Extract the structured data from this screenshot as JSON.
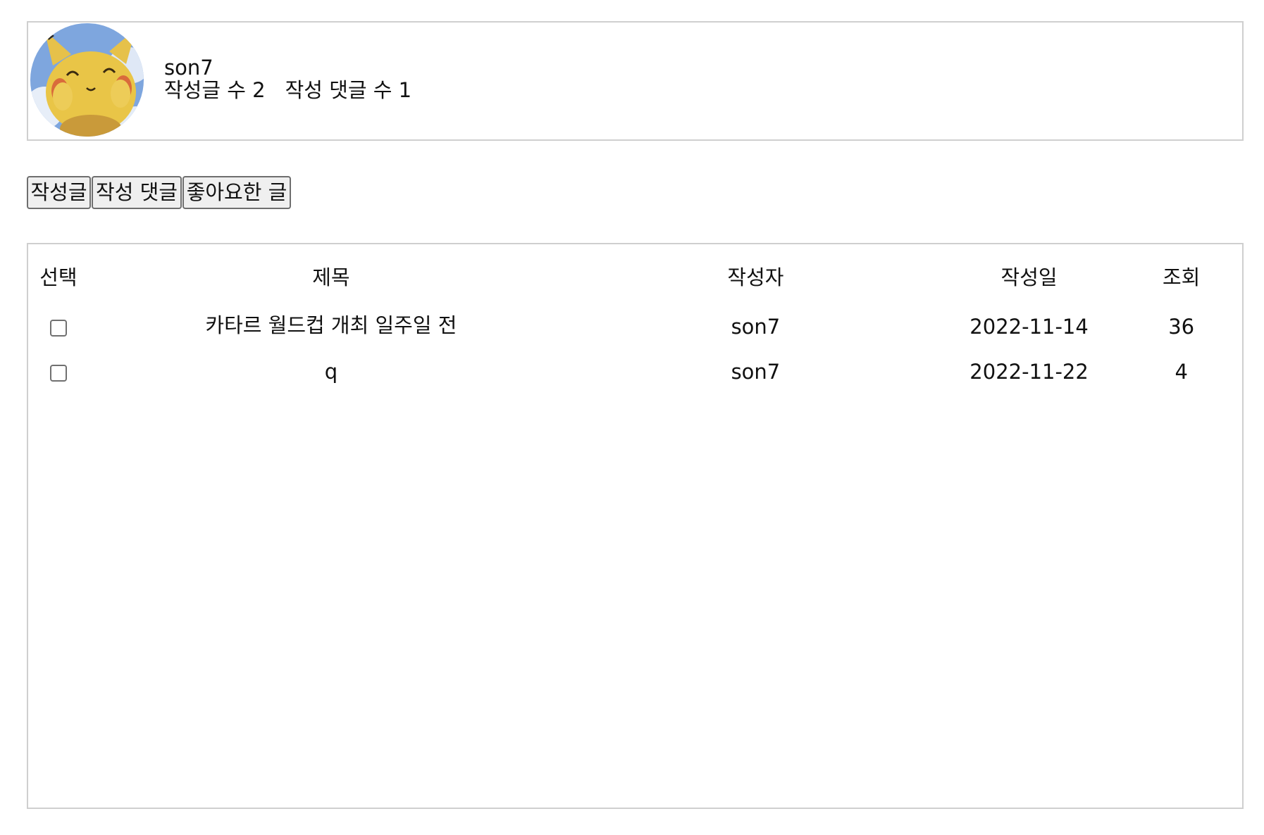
{
  "profile": {
    "username": "son7",
    "posts_count_label": "작성글 수 2",
    "comments_count_label": "작성 댓글 수 1",
    "avatar_icon": "pikachu-avatar"
  },
  "tabs": [
    {
      "label": "작성글"
    },
    {
      "label": "작성 댓글"
    },
    {
      "label": "좋아요한 글"
    }
  ],
  "table": {
    "headers": {
      "select": "선택",
      "title": "제목",
      "author": "작성자",
      "date": "작성일",
      "views": "조회"
    },
    "rows": [
      {
        "checked": false,
        "title": "카타르 월드컵 개최 일주일 전",
        "author": "son7",
        "date": "2022-11-14",
        "views": "36"
      },
      {
        "checked": false,
        "title": "q",
        "author": "son7",
        "date": "2022-11-22",
        "views": "4"
      }
    ]
  },
  "colors": {
    "box_border": "#cfcfcf",
    "button_bg": "#efefef",
    "button_border": "#6e6e6e"
  }
}
